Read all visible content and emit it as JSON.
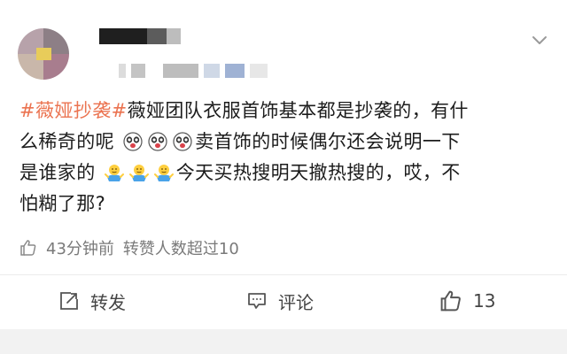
{
  "post": {
    "hashtag": "#薇娅抄袭#",
    "text_line1": "薇娅团队衣服首饰基本都是抄袭的，有什",
    "text_line2_a": "么稀奇的呢",
    "text_line2_b": "卖首饰的时候偶尔还会说明一下",
    "text_line3_a": "是谁家的",
    "text_line3_b": "今天买热搜明天撤热搜的，哎，不",
    "text_line4": "怕糊了那?",
    "emoji_set1": "panda-shocked-emoji",
    "emoji_set2": "shrug-emoji"
  },
  "meta": {
    "time": "43分钟前",
    "reposters": "转赞人数超过10"
  },
  "actions": {
    "repost_label": "转发",
    "comment_label": "评论",
    "like_count": "13"
  },
  "colors": {
    "hashtag": "#eb7350",
    "text": "#1c1c1c",
    "meta": "#7a7a7a",
    "action": "#444444"
  }
}
